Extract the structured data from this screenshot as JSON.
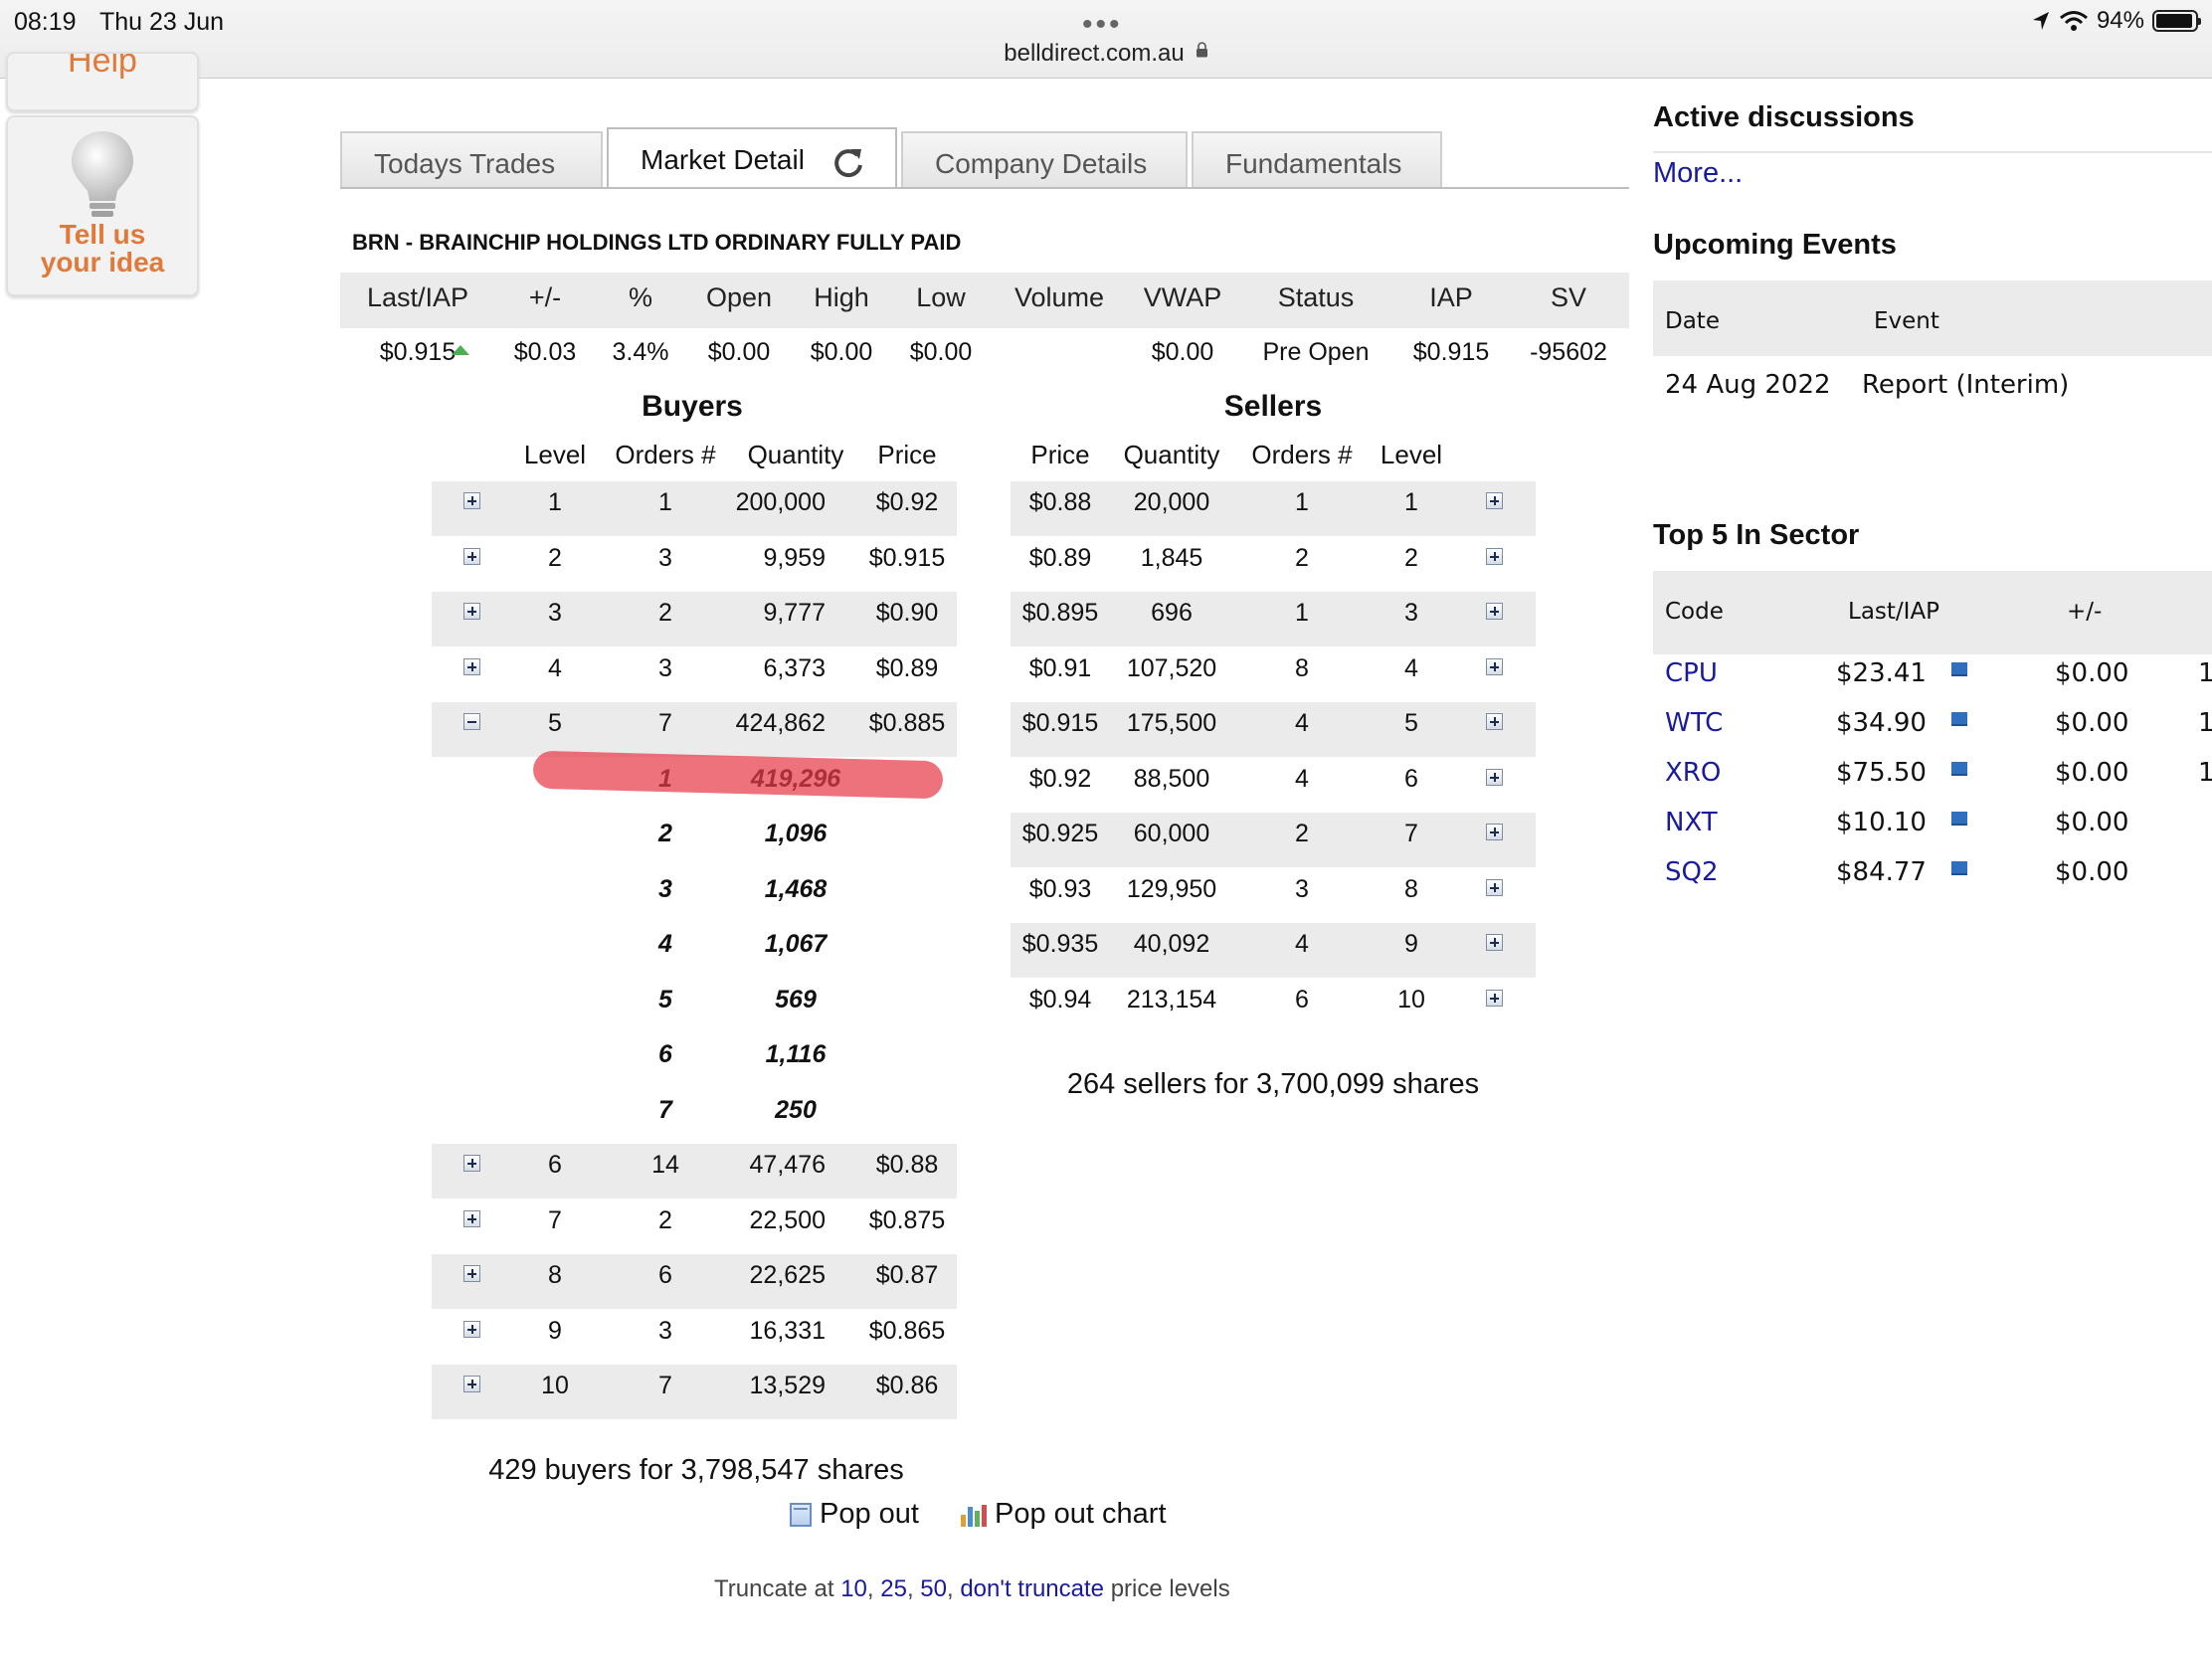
{
  "status_bar": {
    "time": "08:19",
    "date": "Thu 23 Jun",
    "url": "belldirect.com.au",
    "battery": "94%"
  },
  "side": {
    "help_label": "Help",
    "idea_line1": "Tell us",
    "idea_line2": "your idea"
  },
  "tabs": [
    {
      "label": "Todays Trades"
    },
    {
      "label": "Market Detail"
    },
    {
      "label": "Company Details"
    },
    {
      "label": "Fundamentals"
    }
  ],
  "company": "BRN - BRAINCHIP HOLDINGS LTD ORDINARY FULLY PAID",
  "quote": {
    "headers": [
      "Last/IAP",
      "+/-",
      "%",
      "Open",
      "High",
      "Low",
      "Volume",
      "VWAP",
      "Status",
      "IAP",
      "SV"
    ],
    "values": [
      "$0.915",
      "$0.03",
      "3.4%",
      "$0.00",
      "$0.00",
      "$0.00",
      "",
      "$0.00",
      "Pre Open",
      "$0.915",
      "-95602"
    ]
  },
  "buyers": {
    "title": "Buyers",
    "headers": [
      "Level",
      "Orders #",
      "Quantity",
      "Price"
    ],
    "rows": [
      {
        "level": "1",
        "orders": "1",
        "qty": "200,000",
        "price": "$0.92",
        "expanded": false
      },
      {
        "level": "2",
        "orders": "3",
        "qty": "9,959",
        "price": "$0.915",
        "expanded": false
      },
      {
        "level": "3",
        "orders": "2",
        "qty": "9,777",
        "price": "$0.90",
        "expanded": false
      },
      {
        "level": "4",
        "orders": "3",
        "qty": "6,373",
        "price": "$0.89",
        "expanded": false
      },
      {
        "level": "5",
        "orders": "7",
        "qty": "424,862",
        "price": "$0.885",
        "expanded": true
      },
      {
        "level": "6",
        "orders": "14",
        "qty": "47,476",
        "price": "$0.88",
        "expanded": false
      },
      {
        "level": "7",
        "orders": "2",
        "qty": "22,500",
        "price": "$0.875",
        "expanded": false
      },
      {
        "level": "8",
        "orders": "6",
        "qty": "22,625",
        "price": "$0.87",
        "expanded": false
      },
      {
        "level": "9",
        "orders": "3",
        "qty": "16,331",
        "price": "$0.865",
        "expanded": false
      },
      {
        "level": "10",
        "orders": "7",
        "qty": "13,529",
        "price": "$0.86",
        "expanded": false
      }
    ],
    "sub_orders": [
      {
        "n": "1",
        "qty": "419,296"
      },
      {
        "n": "2",
        "qty": "1,096"
      },
      {
        "n": "3",
        "qty": "1,468"
      },
      {
        "n": "4",
        "qty": "1,067"
      },
      {
        "n": "5",
        "qty": "569"
      },
      {
        "n": "6",
        "qty": "1,116"
      },
      {
        "n": "7",
        "qty": "250"
      }
    ],
    "total": "429 buyers for 3,798,547 shares"
  },
  "sellers": {
    "title": "Sellers",
    "headers": [
      "Price",
      "Quantity",
      "Orders #",
      "Level"
    ],
    "rows": [
      {
        "price": "$0.88",
        "qty": "20,000",
        "orders": "1",
        "level": "1"
      },
      {
        "price": "$0.89",
        "qty": "1,845",
        "orders": "2",
        "level": "2"
      },
      {
        "price": "$0.895",
        "qty": "696",
        "orders": "1",
        "level": "3"
      },
      {
        "price": "$0.91",
        "qty": "107,520",
        "orders": "8",
        "level": "4"
      },
      {
        "price": "$0.915",
        "qty": "175,500",
        "orders": "4",
        "level": "5"
      },
      {
        "price": "$0.92",
        "qty": "88,500",
        "orders": "4",
        "level": "6"
      },
      {
        "price": "$0.925",
        "qty": "60,000",
        "orders": "2",
        "level": "7"
      },
      {
        "price": "$0.93",
        "qty": "129,950",
        "orders": "3",
        "level": "8"
      },
      {
        "price": "$0.935",
        "qty": "40,092",
        "orders": "4",
        "level": "9"
      },
      {
        "price": "$0.94",
        "qty": "213,154",
        "orders": "6",
        "level": "10"
      }
    ],
    "total": "264 sellers for 3,700,099 shares"
  },
  "popout": {
    "label": "Pop out",
    "chart_label": "Pop out chart"
  },
  "truncate": {
    "prefix": "Truncate at",
    "opt1": "10",
    "opt2": "25",
    "opt3": "50",
    "opt4": "don't truncate",
    "suffix": "price levels"
  },
  "right": {
    "active_title": "Active discussions",
    "more_link": "More...",
    "upcoming_title": "Upcoming Events",
    "events_headers": [
      "Date",
      "Event"
    ],
    "events": [
      {
        "date": "24 Aug 2022",
        "event": "Report (Interim)"
      }
    ],
    "sector_title": "Top 5 In Sector",
    "sector_headers": [
      "Code",
      "Last/IAP",
      "+/-"
    ],
    "sector": [
      {
        "code": "CPU",
        "last": "$23.41",
        "change": "$0.00",
        "extra": "1"
      },
      {
        "code": "WTC",
        "last": "$34.90",
        "change": "$0.00",
        "extra": "1"
      },
      {
        "code": "XRO",
        "last": "$75.50",
        "change": "$0.00",
        "extra": "1"
      },
      {
        "code": "NXT",
        "last": "$10.10",
        "change": "$0.00",
        "extra": ""
      },
      {
        "code": "SQ2",
        "last": "$84.77",
        "change": "$0.00",
        "extra": ""
      }
    ]
  },
  "colors": {
    "link": "#1a1a9e",
    "band": "#ebebeb",
    "accent_orange": "#e07a3a",
    "highlight": "#e83c4a"
  }
}
